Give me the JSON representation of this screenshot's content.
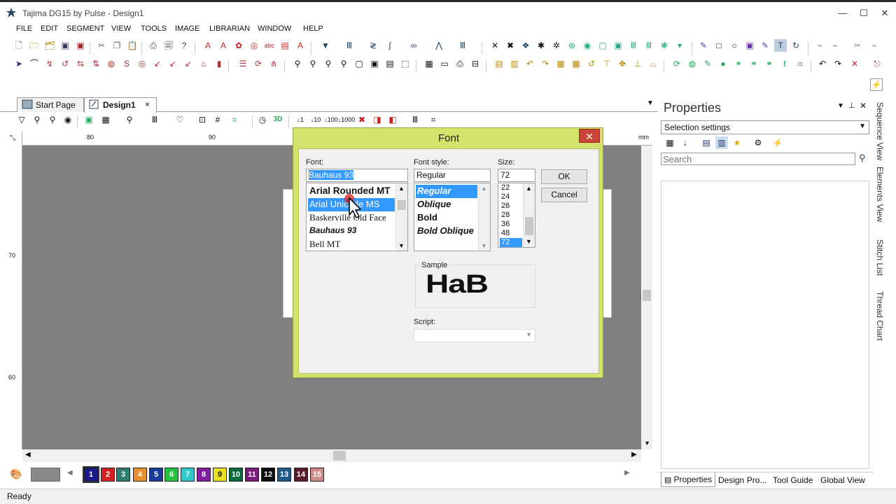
{
  "window": {
    "title": "Tajima DG15 by Pulse - Design1",
    "minimize": "—",
    "maximize": "☐",
    "close": "✕"
  },
  "menu": [
    "FILE",
    "EDIT",
    "SEGMENT",
    "VIEW",
    "TOOLS",
    "IMAGE",
    "LIBRARIAN",
    "WINDOW",
    "HELP"
  ],
  "tabs": {
    "start": "Start Page",
    "design": "Design1",
    "close": "×"
  },
  "ruler": {
    "top": [
      "80",
      "90",
      "mm"
    ],
    "left": [
      "70",
      "60"
    ]
  },
  "palette": [
    "1",
    "2",
    "3",
    "4",
    "5",
    "6",
    "7",
    "8",
    "9",
    "10",
    "11",
    "12",
    "13",
    "14",
    "15"
  ],
  "palette_colors": [
    "#1a1a8c",
    "#d42020",
    "#2e7d6e",
    "#e89030",
    "#1a3a9c",
    "#28c040",
    "#30c8c8",
    "#8020a0",
    "#e8e020",
    "#0a6a3a",
    "#7a1a7a",
    "#0a0a0a",
    "#205a8a",
    "#5a1a2a",
    "#d08a8a"
  ],
  "properties": {
    "title": "Properties",
    "selection": "Selection settings",
    "search_placeholder": "Search",
    "bottom_tabs": [
      "Properties",
      "Design Pro...",
      "Tool Guide",
      "Global View"
    ]
  },
  "side_tabs": [
    "Sequence View",
    "Elements View",
    "Stitch List",
    "Thread Chart"
  ],
  "status": "Ready",
  "font_dialog": {
    "title": "Font",
    "font_label": "Font:",
    "font_value": "Bauhaus 93",
    "fonts": [
      "Arial Rounded MT",
      "Arial Unicode MS",
      "Baskerville Old Face",
      "Bauhaus 93",
      "Bell MT"
    ],
    "selected_font": "Arial Unicode MS",
    "style_label": "Font style:",
    "style_value": "Regular",
    "styles": [
      "Regular",
      "Oblique",
      "Bold",
      "Bold Oblique"
    ],
    "size_label": "Size:",
    "size_value": "72",
    "sizes": [
      "22",
      "24",
      "26",
      "28",
      "36",
      "48",
      "72"
    ],
    "ok": "OK",
    "cancel": "Cancel",
    "sample_label": "Sample",
    "sample_text": "HaB",
    "script_label": "Script:"
  }
}
